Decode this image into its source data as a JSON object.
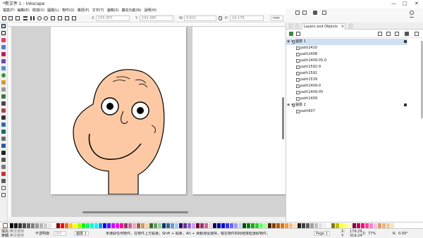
{
  "window": {
    "title": "*新文件 1 - Inkscape",
    "controls": [
      "—",
      "□",
      "✕"
    ]
  },
  "menu": [
    "檔案(F)",
    "編輯(E)",
    "檢視(V)",
    "圖層(L)",
    "物件(O)",
    "路徑(P)",
    "文字(T)",
    "濾鏡(S)",
    "擴充功能(N)",
    "說明(H)"
  ],
  "tool_controls": {
    "x_label": "X",
    "x": "155.307",
    "y_label": "Y",
    "y": "193.485",
    "w_label": "W",
    "w": "9.621",
    "h_label": "H",
    "h": "14.179",
    "unit": "mm"
  },
  "panel": {
    "tab_label": "Layers and Objects",
    "tab_close": "✕",
    "layers": [
      {
        "name": "圖層 1",
        "objects": [
          "path2410",
          "path2408",
          "path1409-05-0",
          "path1592-9",
          "path1592",
          "path1539",
          "path1409-0",
          "path1409-05",
          "path1409"
        ]
      },
      {
        "name": "圖層 2",
        "objects": [
          "path607"
        ]
      }
    ]
  },
  "status": {
    "fill_label": "填充:",
    "fill_value": "無法使用",
    "stroke_label": "筆觸:",
    "stroke_value": "無法使用",
    "opacity_label": "不透明度:",
    "opacity_value": "100",
    "layer_label": "圖層 1",
    "message": "未選取任何物件。在物件上方點選，Shift + 點擊，Alt + 滑動滑鼠選擇，或在物件四周拖曳框選取物件。",
    "page_label": "Page 1",
    "x_label": "X:",
    "x": "179.29",
    "y_label": "Y:",
    "y": "319.24",
    "zoom_label": "Z:",
    "zoom": "77%",
    "rotate_label": "R:",
    "rotate": "0.00°"
  },
  "colors": {
    "face_fill": "#fcc9a4",
    "stroke": "#000000",
    "selection": "#cfe0f5",
    "canvas_bg": "#d2d2d2"
  },
  "palette": [
    "#000000",
    "#1a1a1a",
    "#333333",
    "#4d4d4d",
    "#666666",
    "#808080",
    "#999999",
    "#b3b3b3",
    "#cccccc",
    "#e6e6e6",
    "#ffffff",
    "#800000",
    "#ff0000",
    "#ff6600",
    "#ffcc00",
    "#ffff00",
    "#99ff00",
    "#00ff00",
    "#00ff66",
    "#00ffcc",
    "#00ffff",
    "#0099ff",
    "#0000ff",
    "#6600ff",
    "#cc00ff",
    "#ff00ff",
    "#ff0099",
    "#993366",
    "#cc6699",
    "#ff99cc",
    "#996633",
    "#cc9966",
    "#ffcc99",
    "#336633",
    "#669966",
    "#99cc99",
    "#003366",
    "#336699",
    "#6699cc",
    "#99ccff",
    "#330066",
    "#663399",
    "#9966cc",
    "#cc99ff",
    "#660033",
    "#993366",
    "#cc6699",
    "#ffccdd",
    "#000066",
    "#000099",
    "#0000cc",
    "#3333ff",
    "#6666ff",
    "#9999ff",
    "#ccccff",
    "#004d00",
    "#008000",
    "#00b300",
    "#33cc33",
    "#66ff66",
    "#aaffaa",
    "#4d2600",
    "#804000",
    "#b35900",
    "#e67300",
    "#ff9933",
    "#ffbb77",
    "#ffe0c0",
    "#202020",
    "#404040",
    "#606060",
    "#a0a0a0",
    "#c0c0c0",
    "#e0e0e0",
    "#f0f0f0",
    "#fafafa",
    "#7f7f00",
    "#bfbf00",
    "#ffff40",
    "#ffff80",
    "#ffffbf",
    "#800040",
    "#bf0060",
    "#ff0080",
    "#ff40a0",
    "#ff80c0",
    "#ffbfe0",
    "#d9a066",
    "#e6b380",
    "#f2c999",
    "#ffe0b3"
  ]
}
